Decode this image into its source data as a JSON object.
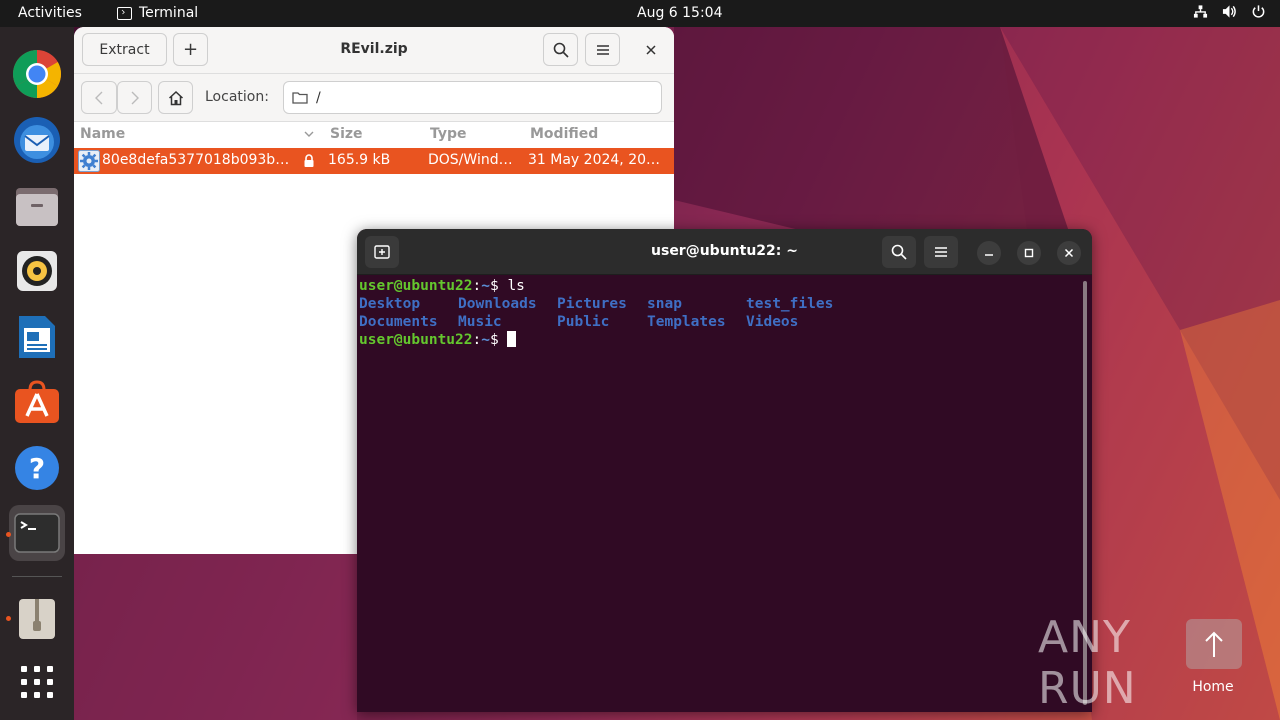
{
  "topbar": {
    "activities": "Activities",
    "app_name": "Terminal",
    "clock": "Aug 6  15:04"
  },
  "dock": {
    "items": [
      "chrome-icon",
      "thunderbird-icon",
      "files-icon",
      "rhythmbox-icon",
      "writer-icon",
      "app-center-icon",
      "help-icon",
      "terminal-icon",
      "archive-manager-icon",
      "app-grid-icon"
    ]
  },
  "archive": {
    "title": "REvil.zip",
    "extract_label": "Extract",
    "add_label": "+",
    "location_label": "Location:",
    "location_value": "/",
    "columns": [
      "Name",
      "Size",
      "Type",
      "Modified"
    ],
    "rows": [
      {
        "name": "80e8defa5377018b093b…",
        "size": "165.9 kB",
        "type": "DOS/Wind…",
        "modified": "31 May 2024, 20…"
      }
    ]
  },
  "terminal": {
    "title": "user@ubuntu22: ~",
    "prompt_user": "user@ubuntu22",
    "prompt_sep": ":",
    "prompt_path": "~",
    "prompt_end": "$ ",
    "command": "ls",
    "listing_row1": [
      "Desktop",
      "Downloads",
      "Pictures",
      "snap",
      "test_files"
    ],
    "listing_row2": [
      "Documents",
      "Music",
      "Public",
      "Templates",
      "Videos"
    ]
  },
  "desktop": {
    "home_label": "Home",
    "watermark": "ANY RUN"
  },
  "colors": {
    "accent": "#e95420",
    "terminal_bg": "#300a24"
  }
}
